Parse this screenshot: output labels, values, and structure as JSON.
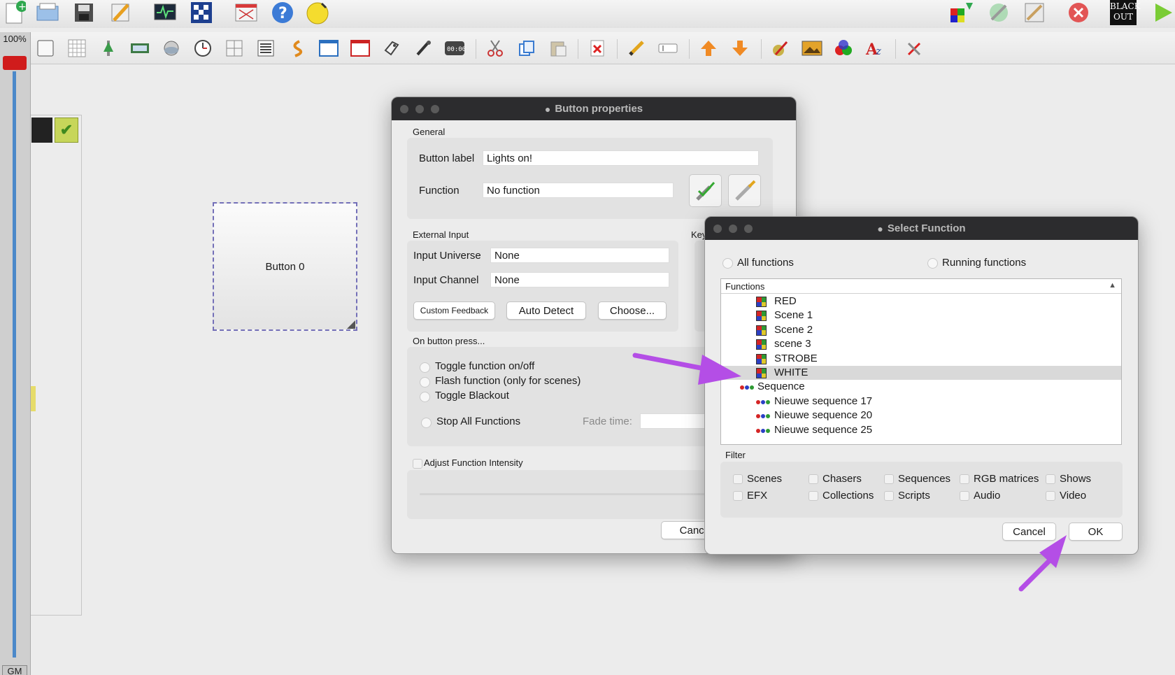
{
  "toolbar": {
    "zoom": "100%",
    "gm_label": "GM",
    "blackout_line1": "BLACK",
    "blackout_line2": "OUT"
  },
  "canvas": {
    "button_label": "Button 0"
  },
  "button_props": {
    "title": "Button properties",
    "general_label": "General",
    "button_label_label": "Button label",
    "button_label_value": "Lights on!",
    "function_label": "Function",
    "function_value": "No function",
    "external_input_label": "External Input",
    "key_label": "Key",
    "input_universe_label": "Input Universe",
    "input_universe_value": "None",
    "input_channel_label": "Input Channel",
    "input_channel_value": "None",
    "custom_feedback": "Custom Feedback",
    "auto_detect": "Auto Detect",
    "choose": "Choose...",
    "on_press_label": "On button press...",
    "opt_toggle": "Toggle function on/off",
    "opt_flash": "Flash function (only for scenes)",
    "opt_blackout": "Toggle Blackout",
    "opt_stop_all": "Stop All Functions",
    "fade_time_label": "Fade time:",
    "adjust_intensity": "Adjust Function Intensity",
    "cancel": "Cancel"
  },
  "select_function": {
    "title": "Select Function",
    "all_functions": "All functions",
    "running_functions": "Running functions",
    "tree_header": "Functions",
    "items": [
      {
        "label": "RED",
        "kind": "scene"
      },
      {
        "label": "Scene 1",
        "kind": "scene"
      },
      {
        "label": "Scene 2",
        "kind": "scene"
      },
      {
        "label": "scene 3",
        "kind": "scene"
      },
      {
        "label": "STROBE",
        "kind": "scene"
      },
      {
        "label": "WHITE",
        "kind": "scene",
        "selected": true
      },
      {
        "label": "Sequence",
        "kind": "folder"
      },
      {
        "label": "Nieuwe sequence 17",
        "kind": "sequence"
      },
      {
        "label": "Nieuwe sequence 20",
        "kind": "sequence"
      },
      {
        "label": "Nieuwe sequence 25",
        "kind": "sequence"
      }
    ],
    "filter_label": "Filter",
    "filters": {
      "scenes": "Scenes",
      "chasers": "Chasers",
      "sequences": "Sequences",
      "rgb": "RGB matrices",
      "shows": "Shows",
      "efx": "EFX",
      "collections": "Collections",
      "scripts": "Scripts",
      "audio": "Audio",
      "video": "Video"
    },
    "cancel": "Cancel",
    "ok": "OK"
  },
  "colors": {
    "annotation_arrow": "#b44ee6",
    "dialog_titlebar": "#2c2c2e",
    "master_fader": "#d01c1c"
  }
}
